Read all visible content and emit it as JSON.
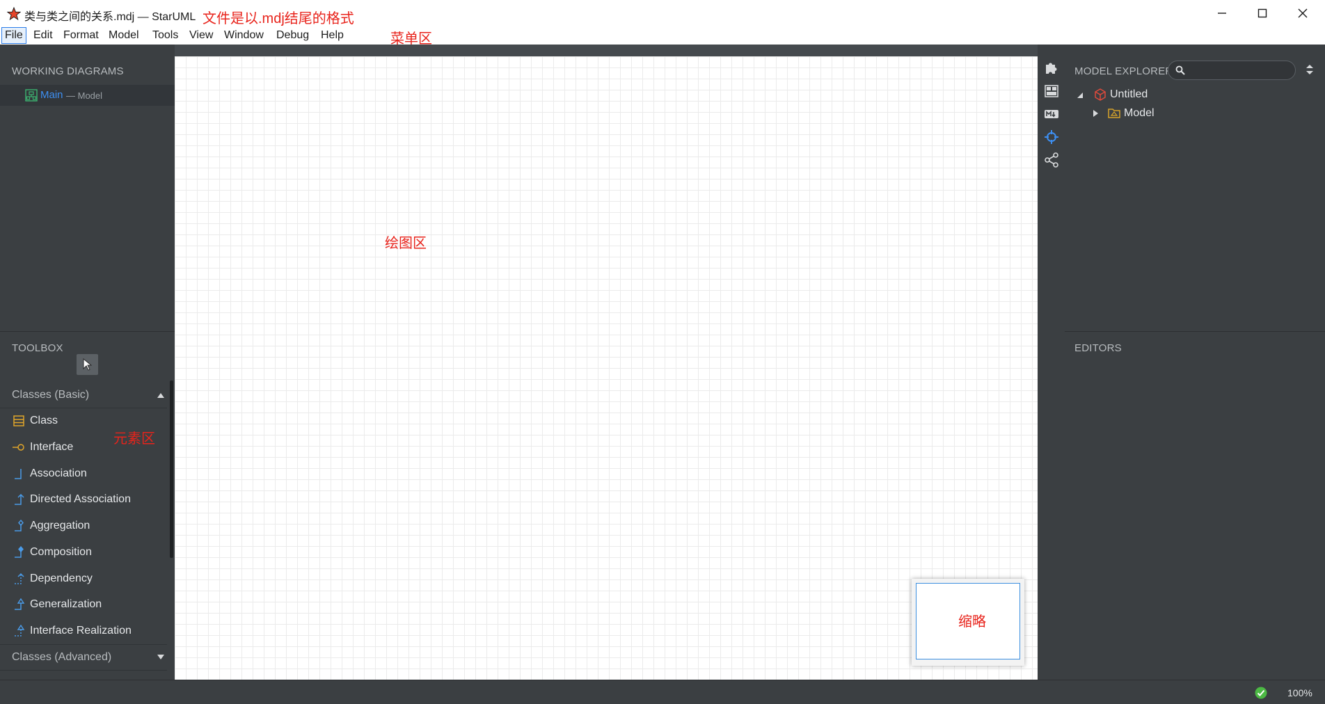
{
  "window": {
    "title": "类与类之间的关系.mdj — StarUML",
    "controls": [
      "minimize",
      "maximize",
      "close"
    ]
  },
  "annotations": {
    "file_format": "文件是以.mdj结尾的格式",
    "menu_area": "菜单区",
    "drawing_area": "绘图区",
    "element_area": "元素区",
    "thumbnail": "缩略"
  },
  "menubar": {
    "items": [
      "File",
      "Edit",
      "Format",
      "Model",
      "Tools",
      "View",
      "Window",
      "Debug",
      "Help"
    ],
    "active": "File"
  },
  "working_diagrams": {
    "title": "WORKING DIAGRAMS",
    "items": [
      {
        "name": "Main",
        "context": "— Model"
      }
    ]
  },
  "toolbox": {
    "title": "TOOLBOX",
    "groups": [
      {
        "label": "Classes (Basic)",
        "expanded": true,
        "items": [
          {
            "label": "Class",
            "icon": "class-icon"
          },
          {
            "label": "Interface",
            "icon": "interface-icon"
          },
          {
            "label": "Association",
            "icon": "association-icon"
          },
          {
            "label": "Directed Association",
            "icon": "directed-association-icon"
          },
          {
            "label": "Aggregation",
            "icon": "aggregation-icon"
          },
          {
            "label": "Composition",
            "icon": "composition-icon"
          },
          {
            "label": "Dependency",
            "icon": "dependency-icon"
          },
          {
            "label": "Generalization",
            "icon": "generalization-icon"
          },
          {
            "label": "Interface Realization",
            "icon": "interface-realization-icon"
          }
        ]
      },
      {
        "label": "Classes (Advanced)",
        "expanded": false,
        "items": []
      }
    ]
  },
  "model_explorer": {
    "title": "MODEL EXPLORER",
    "search_value": "",
    "tree": [
      {
        "label": "Untitled",
        "icon": "project-icon",
        "expanded": true,
        "depth": 0
      },
      {
        "label": "Model",
        "icon": "model-icon",
        "expanded": false,
        "depth": 1
      }
    ]
  },
  "editors": {
    "title": "EDITORS"
  },
  "statusbar": {
    "zoom": "100%",
    "validation": "ok"
  },
  "colors": {
    "accent": "#2b7de9",
    "annotation": "#e8231b",
    "panel_bg": "#3b3f42",
    "canvas_bg": "#ffffff"
  }
}
